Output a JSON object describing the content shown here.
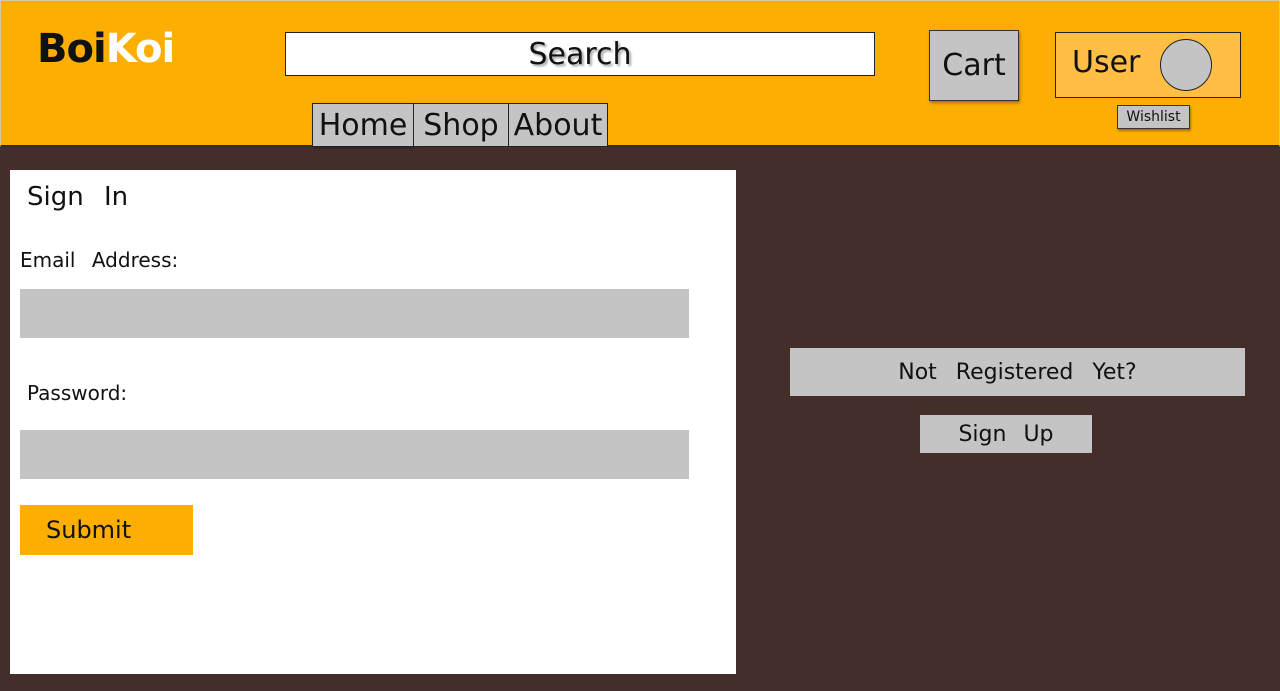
{
  "header": {
    "logo_part1": "Boi",
    "logo_part2": "Koi",
    "search_label": "Search",
    "cart_label": "Cart",
    "user_label": "User",
    "wishlist_label": "Wishlist",
    "nav": {
      "home": "Home",
      "shop": "Shop",
      "about": "About"
    }
  },
  "signin": {
    "title": "Sign In",
    "email_label": "Email Address:",
    "email_value": "",
    "password_label": "Password:",
    "password_value": "",
    "submit_label": "Submit"
  },
  "register": {
    "prompt": "Not Registered Yet?",
    "signup_label": "Sign Up"
  },
  "colors": {
    "header_bg": "#fdae02",
    "page_bg": "#432e29",
    "control_gray": "#c4c4c4",
    "user_box_bg": "#ffbe44"
  },
  "icons": {
    "avatar": "user-avatar-circle"
  }
}
